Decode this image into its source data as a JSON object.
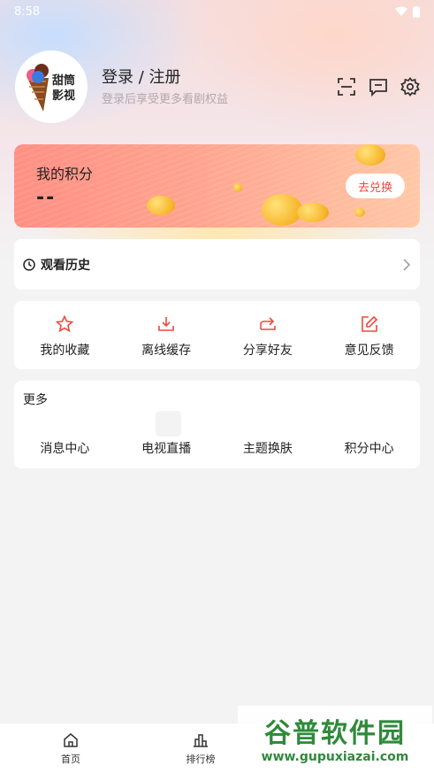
{
  "status": {
    "time": "8:58"
  },
  "header": {
    "avatar_text": "甜筒影视",
    "login_title": "登录 / 注册",
    "login_subtitle": "登录后享受更多看剧权益"
  },
  "points": {
    "title": "我的积分",
    "value": "--",
    "redeem_label": "去兑换"
  },
  "history": {
    "label": "观看历史"
  },
  "quick_actions": [
    {
      "label": "我的收藏",
      "icon": "star-icon"
    },
    {
      "label": "离线缓存",
      "icon": "download-icon"
    },
    {
      "label": "分享好友",
      "icon": "share-icon"
    },
    {
      "label": "意见反馈",
      "icon": "edit-icon"
    }
  ],
  "more": {
    "title": "更多",
    "items": [
      "消息中心",
      "电视直播",
      "主题换肤",
      "积分中心"
    ]
  },
  "tabbar": {
    "items": [
      {
        "label": "首页",
        "icon": "home-icon"
      },
      {
        "label": "排行榜",
        "icon": "ranking-icon"
      }
    ]
  },
  "watermark": {
    "title": "谷普软件园",
    "url": "www.gupuxiazai.com"
  },
  "colors": {
    "accent": "#ee4a3f",
    "card_gradient_start": "#ff8f84",
    "card_gradient_end": "#ffc8a6"
  }
}
